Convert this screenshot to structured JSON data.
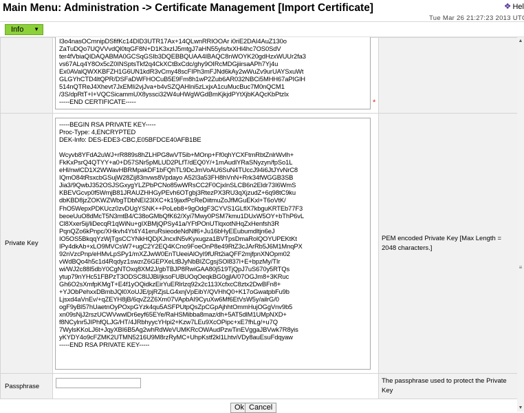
{
  "header": {
    "title": "Main Menu: Administration -> Certificate Management [Import Certificate]",
    "help_label": "Hel",
    "timestamp": "Tue Mar 26 21:27:23 2013 UTC"
  },
  "toolbar": {
    "info_label": "Info"
  },
  "certificate": {
    "text": "I3o4nasOCmnipDSfifKc14DID3UTR17Ax+14QLwnRRIOOAr i0riE2DAI4AuZ130o\nZaTuDQo7UQVVvdQl0tqGF8N+D1K3xzIJ5mtgJ7aHN55yls/txXHl4hc7OS0SdV\nter4fVbiaQIDAQABMA0GCSqGSIb3DQEBBQUAA4IBAQC8nWOYK20gdHzxWUUr2fa3\nvs67ALq4Y8Ox5cZ0INSptsTkf2q4CkXCtBxCdc/ghy9OIRcMDGjiirsaAPh7Yj4u\nEx0AValQWXKBFZH1G6UN1kdR3vCmy48scFIPh3mFJNd6kAy2wWuZv9urUAYSxuWt\nGLGYhCTD4ltQPR/DSFaDWFHOCuB5E9Fm8h1wP2Zub6AR032NBCi5MHH67aPIGlH\n514nQTReJ4Xhevt7JxEMIi2vjJva+b4vSZQAHlni5zLxjxA1cuMucBuc7M0nQCM1\n/3S/dpRtT+I+VQCSicammUX8yssci32W4uHWgWGdBmKjkjdPYtXjbKAQcKbPtzlx\n-----END CERTIFICATE-----"
  },
  "private_key": {
    "label": "Private Key",
    "help": "PEM encoded Private Key [Max Length = 2048 characters.]",
    "text": "-----BEGIN RSA PRIVATE KEY-----\nProc-Type: 4,ENCRYPTED\nDEK-Info: DES-EDE3-CBC,E05BFDCE40AFB1BE\n\nWcyvb8YFdA2uWJ+rR889s8hZLHPG8wVT5ib+MOnp+Ff0qhYCXFtmRbtZnlrWvlh+\nFkKxPsrQ4QTYY+a0+D57SNr5pMLUD2PLfT/dEQ0Y/+1mAudlYRaSNyzyn/fpSo1L\neHl/nwlCD1X2WWavHBRMpakDF1bFQhTL9DcJmVoAU6SuN4TUccJ94i6JtJYvNrC8\nIQmO84tRsxcbGSujW28Zij83nvws8Vpdayo A52I3a53FH8hVnN+Rrk34fWGGB3SB\nJia3/9QwbJ352OSJSGxygYLZPbPCNo85wWRsCC2F0CjxlnSLCB6n2Eldr73I6WmS\nKBEVGcvp0f5WmjB81JRAUZHHGyPEvh6OTgbj3RtezPX3RU3qXjzudZ+6q98tC9ku\ndbKBD8jzZOKWZWbgTDbNEI23IXC+k19jaxfPcReDiitmuZoJfMGuEKxl+T6oVtK/\nFhO5WepxPDKUcz0zvDUgYSNK++PoLeb8+9gOdgF3CYVS1GLflX7kbguKRTEb77F3\nbeoeUuO8dMcT5N3mtB4/C38oGMbQfK62/Xyi7Mwy0PSM7kmu1DUxW5OY+bThP6vL\nCl8Xxer5ij/liDecqR1qWiNu+gIXBMjQPSy41a/YFtPOnUTlqxotNHqZxHenfsh3R\nPqnQZo6kPnpc/XHkvh4Yt4Y41eruRsieodeNdNlf6+Ju16bHyEEubumdltjn6eJ\nIO5OS5BkqqYzWjTgsCCYNkHQDjXJncxlN5vKyxugza1BVTpsDmaRolQOYUPEKtKt\nIPy4dkAb+xLO9MVCsW7+ugC2Y2EQ4KCno9FoeOnP8e49RtZ3cJArRb5J6M1MnqPX\n92nVzcPnp/eHMvLpSPy1/mXZJwW0EnTUeeiAlOyI9fURt2iaQFF2mjfpnXNOpm02\nvWdBQo4h5c1d4Rqdyz1swzrZ6GEPXeLtBJyNbBIZCgsjSOl837l+E+bpzMy/TIr\nwi/WJ2c88l5dbY0CgNTOxq8XM2J/gbTBJP8RwiGAA80j519TjQpJ7uS670y5RTQs\nytup79nYHc51FBPzT3ODSC8lJJBl/jksoFUBUOqOeqkBG0gjlA/07OGJm8+3KRuc\nGh6O2sXmfpKMgT+E4f1yOQidkzEirYuERlrlzq92x2c113XcfxcC8ztx2DwBFn8+\n+YJObPehxxDBmbJQl0XoUJE/pjRZjsLG4xnjVpEibY/QVHhQ0+K17oGwatpbFu9b\nLjsxd4aVnEv/+qZEYH8jB/6qvZ2Z6Xm07VApbAI9CyuXw6Mf6EtVsW5y/ailrG/0\nogF9yBl57hUaetnOyPOxpGYzk4qu5ASFPUtpQsZpCGpAjhhtOmmHujOGgVnv9b5\nxn09sNjJ2rszUCWVwwlDr6eyf65EYe/RaHSMibba8maz/dh+5AT5dlM1UMpNXD+\nf8NCylnr5JIPhfQLJG/HT/4JRbhyycYHpi2+Kzw7LEu9XcOPipc+xE7fhLg/+u7Q\n7WylsKKoLJ6t+JqyXBI6B5Ag2whRdWeVUMKRcOWAudPzwTinEVggaJBVwk7R8yis\nyKYDY4o9cFZMK2UTMN5216U9M8rzRyMC+UhpKstf2kl1LhtviVDy8auEsuFdqyaw\n-----END RSA PRIVATE KEY-----"
  },
  "passphrase": {
    "label": "Passphrase",
    "value": "",
    "help": "The passphrase used to protect the Private Key"
  },
  "actions": {
    "ok_label": "Ok",
    "cancel_label": "Cancel"
  },
  "colors": {
    "info_button": "#8cd03a",
    "label_cell": "#f1f1f1",
    "required_marker": "#e02020"
  }
}
